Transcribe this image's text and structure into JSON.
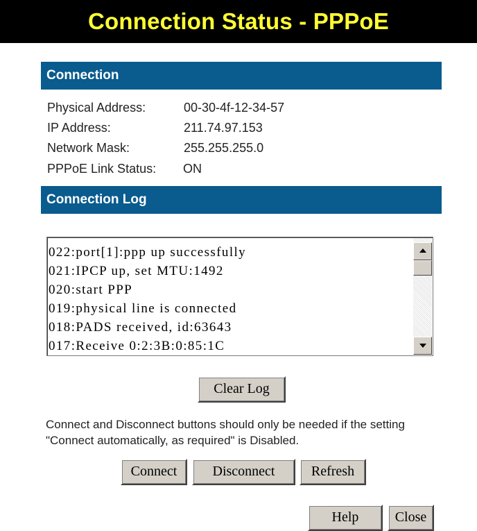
{
  "header": {
    "title": "Connection Status - PPPoE"
  },
  "connection": {
    "section_title": "Connection",
    "fields": [
      {
        "label": "Physical Address:",
        "value": "00-30-4f-12-34-57"
      },
      {
        "label": "IP Address:",
        "value": "211.74.97.153"
      },
      {
        "label": "Network Mask:",
        "value": "255.255.255.0"
      },
      {
        "label": "PPPoE Link Status:",
        "value": "ON"
      }
    ]
  },
  "log": {
    "section_title": "Connection Log",
    "lines": [
      "022:port[1]:ppp up successfully",
      "021:IPCP up, set MTU:1492",
      "020:start PPP",
      "019:physical line is connected",
      "018:PADS received, id:63643",
      "017:Receive 0:2:3B:0:85:1C"
    ],
    "clear_label": "Clear Log"
  },
  "note": "Connect and Disconnect buttons should only be needed if the setting \"Connect automatically, as required\" is Disabled.",
  "actions": {
    "connect_label": "Connect",
    "disconnect_label": "Disconnect",
    "refresh_label": "Refresh",
    "help_label": "Help",
    "close_label": "Close"
  },
  "colors": {
    "title_bg": "#000000",
    "title_text": "#ffff33",
    "section_bar": "#0a5b8e",
    "button_face": "#d4d0c8"
  }
}
